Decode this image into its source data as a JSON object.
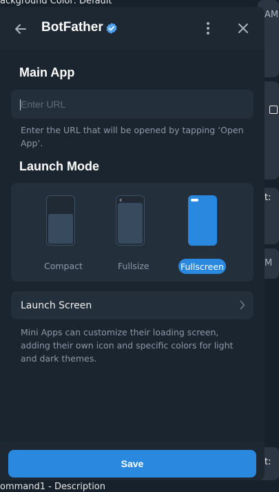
{
  "background": {
    "top_text": "ackground Color: Default",
    "bottom_text": "ommand1 - Description",
    "side_fragments": [
      "AM",
      "t:",
      "M",
      "t:"
    ]
  },
  "header": {
    "title": "BotFather",
    "back_icon": "arrow-left-icon",
    "verified_icon": "verified-badge-icon",
    "more_icon": "more-vertical-icon",
    "close_icon": "close-icon"
  },
  "main_app": {
    "title": "Main App",
    "url_value": "",
    "url_placeholder": "Enter URL",
    "hint": "Enter the URL that will be opened by tapping ‘Open App’."
  },
  "launch_mode": {
    "title": "Launch Mode",
    "modes": [
      {
        "label": "Compact",
        "selected": false
      },
      {
        "label": "Fullsize",
        "selected": false
      },
      {
        "label": "Fullscreen",
        "selected": true
      }
    ]
  },
  "launch_screen": {
    "label": "Launch Screen",
    "chevron_icon": "chevron-right-icon",
    "description": "Mini Apps can customize their loading screen, adding their own icon and specific colors for light and dark themes."
  },
  "footer": {
    "save_label": "Save"
  },
  "colors": {
    "accent": "#2a89df",
    "panel": "#1b2530",
    "card": "#242f3c"
  }
}
